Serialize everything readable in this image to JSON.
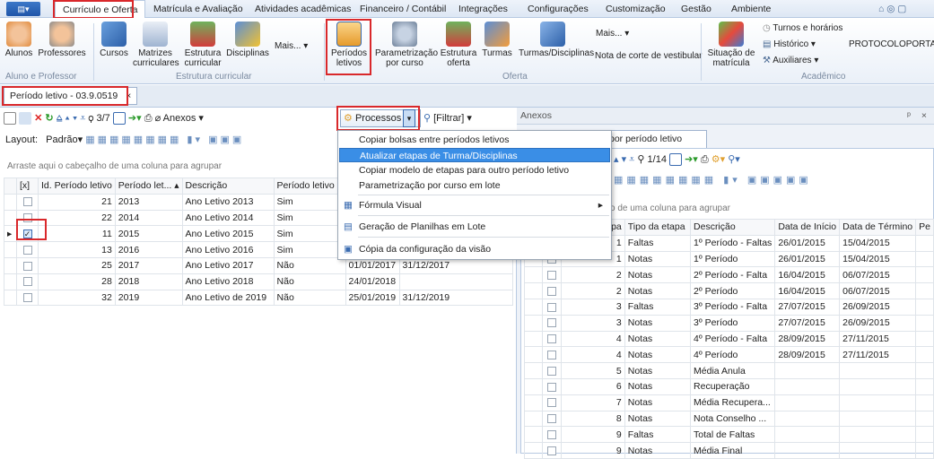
{
  "ribbon_tabs": [
    "Currículo e Oferta",
    "Matrícula e Avaliação",
    "Atividades acadêmicas",
    "Financeiro / Contábil",
    "Integrações",
    "Configurações",
    "Customização",
    "Gestão",
    "Ambiente"
  ],
  "ribbon_buttons": {
    "alunos": "Alunos",
    "professores": "Professores",
    "cursos": "Cursos",
    "matrizes": "Matrizes curriculares",
    "estrutura": "Estrutura curricular",
    "disciplinas": "Disciplinas",
    "mais1": "Mais...",
    "periodos": "Períodos letivos",
    "param": "Parametrização por curso",
    "estrutura_oferta": "Estrutura oferta",
    "turmas": "Turmas",
    "turmas_disc": "Turmas/Disciplinas",
    "mais2": "Mais...",
    "nota_corte": "Nota de corte de vestibular",
    "situacao": "Situação de matrícula",
    "turnos": "Turnos e horários",
    "historico": "Histórico",
    "auxiliares": "Auxiliares",
    "protocolo": "PROTOCOLOPORTAL"
  },
  "groups": {
    "g1": "Aluno e Professor",
    "g2": "Estrutura curricular",
    "g3": "Oferta",
    "g4": "Acadêmico"
  },
  "doc_tab": {
    "label": "Período letivo - 03.9.0519",
    "close": "×"
  },
  "toolbar": {
    "counter": "3/7",
    "anexos": "Anexos",
    "processos": "Processos",
    "filtrar": "[Filtrar]",
    "layout": "Layout:",
    "padrao": "Padrão"
  },
  "group_hint": "Arraste aqui o cabeçalho de uma coluna para agrupar",
  "left_grid": {
    "columns": [
      "[x]",
      "Id. Período letivo",
      "Período let...",
      "Descrição",
      "Período letivo e"
    ],
    "rows": [
      {
        "id": "21",
        "periodo": "2013",
        "desc": "Ano Letivo 2013",
        "e": "Sim",
        "d1": "",
        "d2": ""
      },
      {
        "id": "22",
        "periodo": "2014",
        "desc": "Ano Letivo 2014",
        "e": "Sim",
        "d1": "",
        "d2": ""
      },
      {
        "id": "11",
        "periodo": "2015",
        "desc": "Ano Letivo 2015",
        "e": "Sim",
        "d1": "",
        "d2": ""
      },
      {
        "id": "13",
        "periodo": "2016",
        "desc": "Ano Letivo 2016",
        "e": "Sim",
        "d1": "",
        "d2": ""
      },
      {
        "id": "25",
        "periodo": "2017",
        "desc": "Ano Letivo 2017",
        "e": "Não",
        "d1": "01/01/2017",
        "d2": "31/12/2017"
      },
      {
        "id": "28",
        "periodo": "2018",
        "desc": "Ano Letivo 2018",
        "e": "Não",
        "d1": "24/01/2018",
        "d2": ""
      },
      {
        "id": "32",
        "periodo": "2019",
        "desc": "Ano Letivo de 2019",
        "e": "Não",
        "d1": "25/01/2019",
        "d2": "31/12/2019"
      }
    ]
  },
  "menu": {
    "items": [
      "Copiar bolsas entre períodos letivos",
      "Atualizar etapas de Turma/Disciplinas",
      "Copiar modelo de etapas para outro período letivo",
      "Parametrização por curso em lote",
      "Fórmula Visual",
      "Geração de Planilhas em Lote",
      "Cópia da configuração da visão"
    ],
    "arrow": "▸"
  },
  "right_panel": {
    "header": "Anexos",
    "pin": "ᵖ",
    "close": "×",
    "tab": "por período letivo",
    "counter": "1/14",
    "group_hint": "o de uma coluna para agrupar",
    "columns": [
      "etapa",
      "Tipo da etapa",
      "Descrição",
      "Data de Início",
      "Data de Término",
      "Pe"
    ],
    "rows": [
      {
        "n": "1",
        "tipo": "Faltas",
        "desc": "1º Período - Faltas",
        "ini": "26/01/2015",
        "fim": "15/04/2015"
      },
      {
        "n": "1",
        "tipo": "Notas",
        "desc": "1º Período",
        "ini": "26/01/2015",
        "fim": "15/04/2015"
      },
      {
        "n": "2",
        "tipo": "Notas",
        "desc": "2º Período - Falta",
        "ini": "16/04/2015",
        "fim": "06/07/2015"
      },
      {
        "n": "2",
        "tipo": "Notas",
        "desc": "2º Período",
        "ini": "16/04/2015",
        "fim": "06/07/2015"
      },
      {
        "n": "3",
        "tipo": "Faltas",
        "desc": "3º Período - Falta",
        "ini": "27/07/2015",
        "fim": "26/09/2015"
      },
      {
        "n": "3",
        "tipo": "Notas",
        "desc": "3º Período",
        "ini": "27/07/2015",
        "fim": "26/09/2015"
      },
      {
        "n": "4",
        "tipo": "Notas",
        "desc": "4º Período - Falta",
        "ini": "28/09/2015",
        "fim": "27/11/2015"
      },
      {
        "n": "4",
        "tipo": "Notas",
        "desc": "4º Período",
        "ini": "28/09/2015",
        "fim": "27/11/2015"
      },
      {
        "n": "5",
        "tipo": "Notas",
        "desc": "Média Anula",
        "ini": "",
        "fim": ""
      },
      {
        "n": "6",
        "tipo": "Notas",
        "desc": "Recuperação",
        "ini": "",
        "fim": ""
      },
      {
        "n": "7",
        "tipo": "Notas",
        "desc": "Média Recupera...",
        "ini": "",
        "fim": ""
      },
      {
        "n": "8",
        "tipo": "Notas",
        "desc": "Nota Conselho ...",
        "ini": "",
        "fim": ""
      },
      {
        "n": "9",
        "tipo": "Faltas",
        "desc": "Total de Faltas",
        "ini": "",
        "fim": ""
      },
      {
        "n": "9",
        "tipo": "Notas",
        "desc": "Média Final",
        "ini": "",
        "fim": ""
      }
    ]
  }
}
